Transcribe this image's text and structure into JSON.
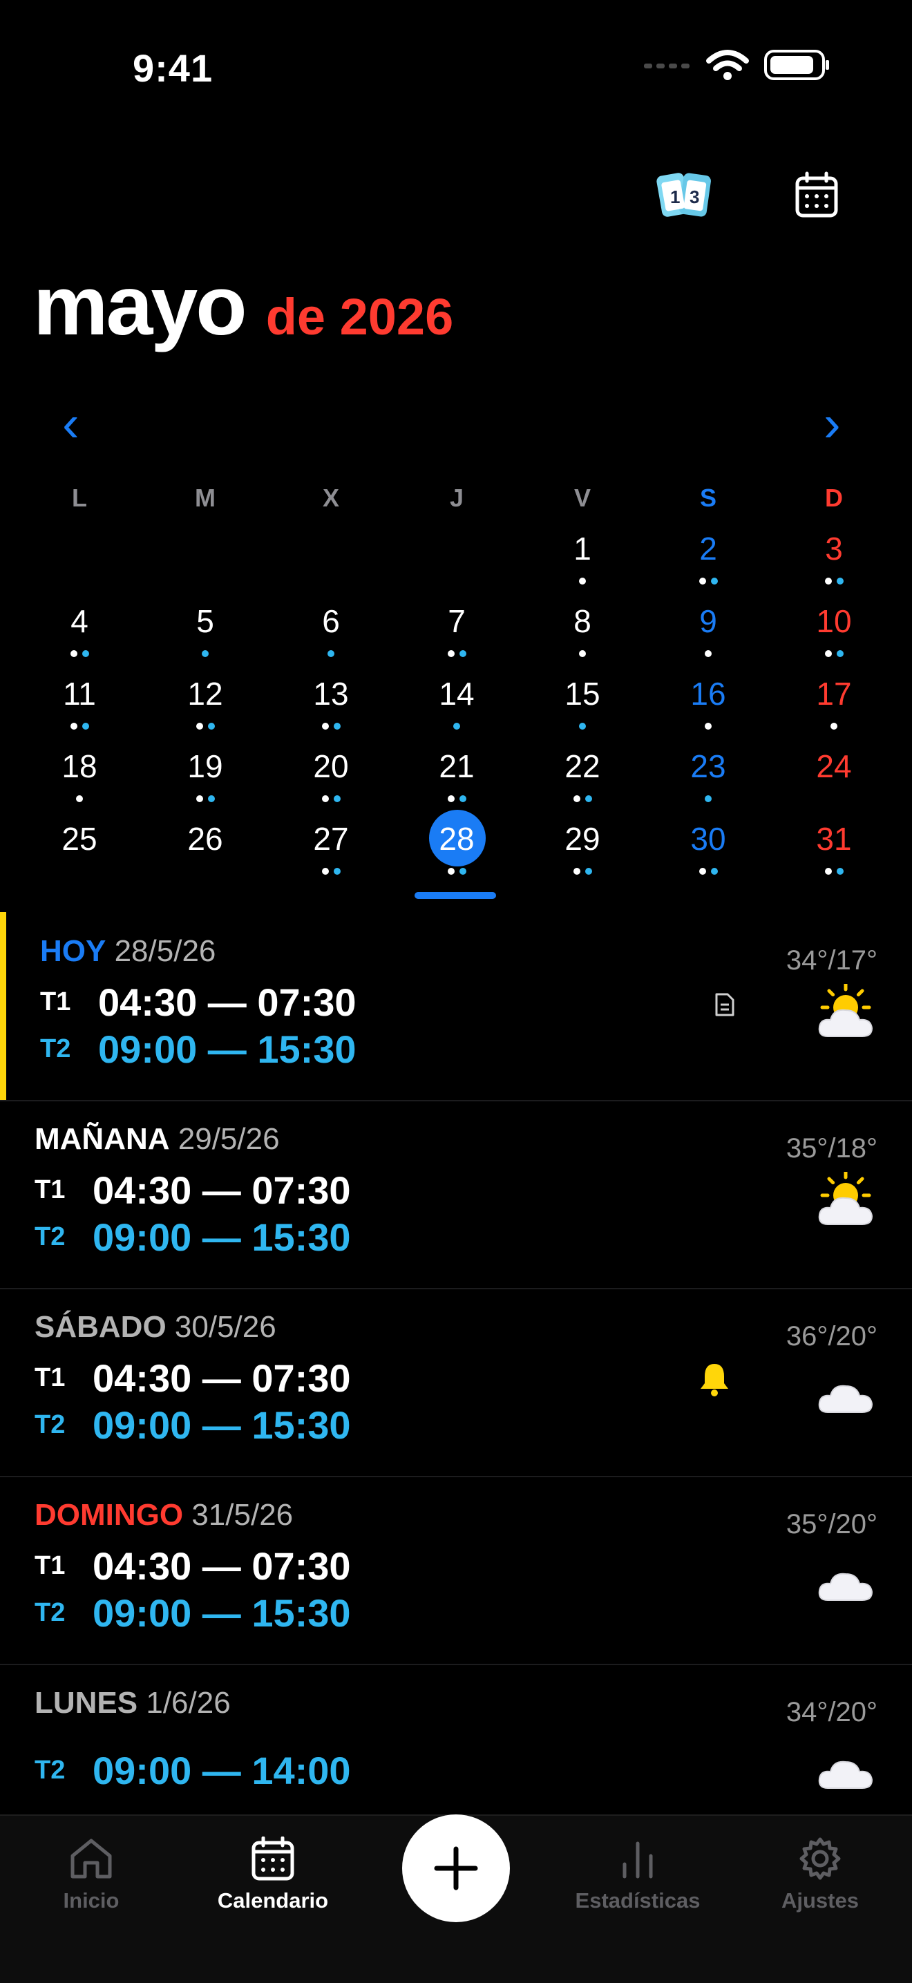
{
  "status": {
    "time": "9:41"
  },
  "header": {
    "month": "mayo",
    "year_text": "de 2026"
  },
  "nav": {
    "prev": "‹",
    "next": "›"
  },
  "weekdays": [
    {
      "label": "L",
      "color": "#8e8e93"
    },
    {
      "label": "M",
      "color": "#8e8e93"
    },
    {
      "label": "X",
      "color": "#8e8e93"
    },
    {
      "label": "J",
      "color": "#8e8e93"
    },
    {
      "label": "V",
      "color": "#8e8e93"
    },
    {
      "label": "S",
      "color": "#1a7cf5"
    },
    {
      "label": "D",
      "color": "#ff3b30"
    }
  ],
  "calendar": {
    "first_weekday_index": 4,
    "selected_day": "28",
    "days": [
      {
        "d": "1",
        "dots": "w"
      },
      {
        "d": "2",
        "dots": "wb"
      },
      {
        "d": "3",
        "dots": "wb"
      },
      {
        "d": "4",
        "dots": "wb"
      },
      {
        "d": "5",
        "dots": "b"
      },
      {
        "d": "6",
        "dots": "b"
      },
      {
        "d": "7",
        "dots": "wb"
      },
      {
        "d": "8",
        "dots": "w"
      },
      {
        "d": "9",
        "dots": "w"
      },
      {
        "d": "10",
        "dots": "wb"
      },
      {
        "d": "11",
        "dots": "wb"
      },
      {
        "d": "12",
        "dots": "wb"
      },
      {
        "d": "13",
        "dots": "wb"
      },
      {
        "d": "14",
        "dots": "b"
      },
      {
        "d": "15",
        "dots": "b"
      },
      {
        "d": "16",
        "dots": "w"
      },
      {
        "d": "17",
        "dots": "w"
      },
      {
        "d": "18",
        "dots": "w"
      },
      {
        "d": "19",
        "dots": "wb"
      },
      {
        "d": "20",
        "dots": "wb"
      },
      {
        "d": "21",
        "dots": "wb"
      },
      {
        "d": "22",
        "dots": "wb"
      },
      {
        "d": "23",
        "dots": "b"
      },
      {
        "d": "24",
        "dots": ""
      },
      {
        "d": "25",
        "dots": ""
      },
      {
        "d": "26",
        "dots": ""
      },
      {
        "d": "27",
        "dots": "wb"
      },
      {
        "d": "28",
        "dots": "wb"
      },
      {
        "d": "29",
        "dots": "wb"
      },
      {
        "d": "30",
        "dots": "wb"
      },
      {
        "d": "31",
        "dots": "wb"
      }
    ]
  },
  "colors": {
    "t1": "#ffffff",
    "t2": "#2fb6f0",
    "today": "#1a7cf5",
    "sunday": "#ff3b30",
    "saturday": "#1a7cf5",
    "bell": "#ffd60a",
    "today_bar": "#ffd60a"
  },
  "list": [
    {
      "label": "HOY",
      "label_color": "#1a7cf5",
      "date": "28/5/26",
      "temp": "34°/17°",
      "weather_icon": "sun-behind-cloud-icon",
      "extra_icon": "note-icon",
      "shifts": [
        {
          "code": "T1",
          "time": "04:30 — 07:30"
        },
        {
          "code": "T2",
          "time": "09:00 — 15:30"
        }
      ]
    },
    {
      "label": "MAÑANA",
      "label_color": "#ffffff",
      "date": "29/5/26",
      "temp": "35°/18°",
      "weather_icon": "sun-behind-cloud-icon",
      "extra_icon": "",
      "shifts": [
        {
          "code": "T1",
          "time": "04:30 — 07:30"
        },
        {
          "code": "T2",
          "time": "09:00 — 15:30"
        }
      ]
    },
    {
      "label": "SÁBADO",
      "label_color": "#b3b3b3",
      "date": "30/5/26",
      "temp": "36°/20°",
      "weather_icon": "cloud-icon",
      "extra_icon": "bell-icon",
      "shifts": [
        {
          "code": "T1",
          "time": "04:30 — 07:30"
        },
        {
          "code": "T2",
          "time": "09:00 — 15:30"
        }
      ]
    },
    {
      "label": "DOMINGO",
      "label_color": "#ff3b30",
      "date": "31/5/26",
      "temp": "35°/20°",
      "weather_icon": "cloud-icon",
      "extra_icon": "",
      "shifts": [
        {
          "code": "T1",
          "time": "04:30 — 07:30"
        },
        {
          "code": "T2",
          "time": "09:00 — 15:30"
        }
      ]
    },
    {
      "label": "LUNES",
      "label_color": "#b3b3b3",
      "date": "1/6/26",
      "temp": "34°/20°",
      "weather_icon": "cloud-icon",
      "extra_icon": "",
      "shifts": [
        {
          "code": "T2",
          "time": "09:00 — 14:00"
        }
      ]
    }
  ],
  "tabs": {
    "inicio": "Inicio",
    "calendario": "Calendario",
    "estadisticas": "Estadísticas",
    "ajustes": "Ajustes",
    "add": "+"
  }
}
